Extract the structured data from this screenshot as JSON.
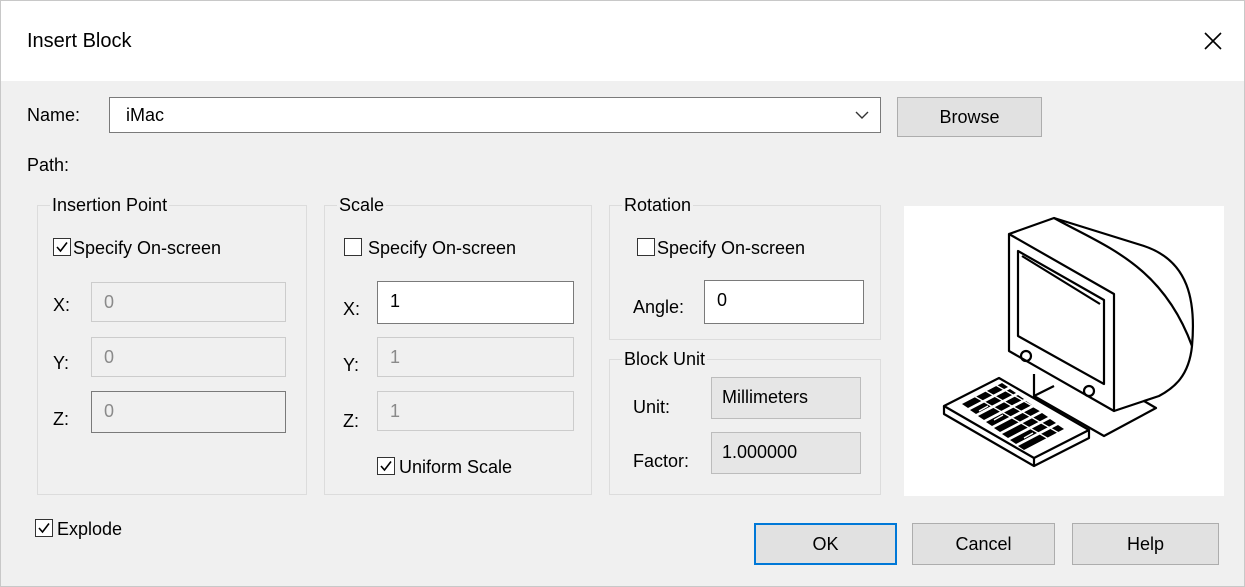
{
  "dialog": {
    "title": "Insert Block"
  },
  "name": {
    "label": "Name:",
    "value": "iMac",
    "browse_label": "Browse"
  },
  "path": {
    "label": "Path:"
  },
  "insertion": {
    "title": "Insertion Point",
    "specify_label": "Specify On-screen",
    "specify_checked": true,
    "x_label": "X:",
    "x_value": "0",
    "y_label": "Y:",
    "y_value": "0",
    "z_label": "Z:",
    "z_value": "0"
  },
  "scale": {
    "title": "Scale",
    "specify_label": "Specify On-screen",
    "specify_checked": false,
    "x_label": "X:",
    "x_value": "1",
    "y_label": "Y:",
    "y_value": "1",
    "z_label": "Z:",
    "z_value": "1",
    "uniform_label": "Uniform Scale",
    "uniform_checked": true
  },
  "rotation": {
    "title": "Rotation",
    "specify_label": "Specify On-screen",
    "specify_checked": false,
    "angle_label": "Angle:",
    "angle_value": "0"
  },
  "block_unit": {
    "title": "Block Unit",
    "unit_label": "Unit:",
    "unit_value": "Millimeters",
    "factor_label": "Factor:",
    "factor_value": "1.000000"
  },
  "explode": {
    "label": "Explode",
    "checked": true
  },
  "buttons": {
    "ok": "OK",
    "cancel": "Cancel",
    "help": "Help"
  },
  "colors": {
    "accent": "#0078d7"
  }
}
